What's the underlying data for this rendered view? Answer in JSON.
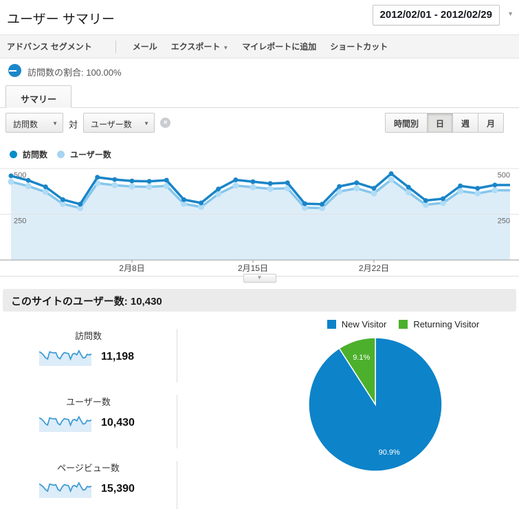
{
  "header": {
    "title": "ユーザー サマリー",
    "date_range": "2012/02/01 - 2012/02/29"
  },
  "icons": {
    "dropdown": "▼",
    "clear": "×",
    "collapse": "▼"
  },
  "toolbar": {
    "advanced_segment": "アドバンス セグメント",
    "mail": "メール",
    "export": "エクスポート",
    "add_to_dashboard": "マイレポートに追加",
    "shortcut": "ショートカット"
  },
  "segment": {
    "label": "訪問数の割合: 100.00%"
  },
  "tabs": {
    "summary": "サマリー"
  },
  "controls": {
    "metric_primary": "訪問数",
    "vs": "対",
    "metric_secondary": "ユーザー数",
    "granularity": [
      {
        "label": "時間別",
        "active": false
      },
      {
        "label": "日",
        "active": true
      },
      {
        "label": "週",
        "active": false
      },
      {
        "label": "月",
        "active": false
      }
    ]
  },
  "legend": {
    "series1": {
      "label": "訪問数",
      "color": "#058dc7"
    },
    "series2": {
      "label": "ユーザー数",
      "color": "#a5d5f0"
    }
  },
  "chart_data": [
    {
      "type": "line",
      "title": "訪問数 対 ユーザー数（日別）",
      "x_range": "2012/02/01 - 2012/02/29",
      "xtick_labels": [
        "2月8日",
        "2月15日",
        "2月22日"
      ],
      "xtick_days": [
        8,
        15,
        22
      ],
      "ylim": [
        0,
        500
      ],
      "yticks": [
        250,
        500
      ],
      "grid": true,
      "series": [
        {
          "name": "訪問数",
          "color": "#1a85c8",
          "dot_color": "#1a85c8",
          "values": [
            460,
            435,
            400,
            330,
            305,
            452,
            440,
            432,
            430,
            436,
            330,
            312,
            388,
            438,
            428,
            418,
            422,
            308,
            305,
            402,
            422,
            392,
            472,
            398,
            325,
            335,
            405,
            392,
            410
          ]
        },
        {
          "name": "ユーザー数",
          "color": "#85c6ec",
          "dot_color": "#b0dcf5",
          "values": [
            428,
            404,
            372,
            307,
            284,
            420,
            409,
            402,
            400,
            405,
            307,
            290,
            361,
            407,
            398,
            389,
            392,
            286,
            284,
            374,
            392,
            364,
            439,
            370,
            302,
            312,
            377,
            364,
            381
          ]
        }
      ],
      "fill_color": "#ddedf8"
    },
    {
      "type": "pie",
      "title": "New vs Returning",
      "legend_position": "top",
      "slices": [
        {
          "label": "New Visitor",
          "value": 90.9,
          "display": "90.9%",
          "color": "#0d83c9"
        },
        {
          "label": "Returning Visitor",
          "value": 9.1,
          "display": "9.1%",
          "color": "#4cb02c"
        }
      ]
    }
  ],
  "summary_bar": {
    "label": "このサイトのユーザー数:",
    "value": "10,430"
  },
  "metrics": [
    {
      "label": "訪問数",
      "value": "11,198",
      "spark": [
        452,
        430,
        392,
        337,
        310,
        450,
        436,
        430,
        434,
        340,
        315,
        390,
        436,
        425,
        418,
        310,
        405,
        420,
        392,
        470,
        396,
        330,
        340,
        402,
        390,
        408
      ]
    },
    {
      "label": "ユーザー数",
      "value": "10,430",
      "spark": [
        420,
        400,
        365,
        313,
        288,
        418,
        406,
        400,
        403,
        316,
        293,
        363,
        405,
        395,
        389,
        288,
        377,
        390,
        364,
        437,
        368,
        307,
        316,
        374,
        363,
        379
      ]
    },
    {
      "label": "ページビュー数",
      "value": "15,390",
      "spark": [
        620,
        585,
        540,
        470,
        428,
        615,
        600,
        588,
        596,
        470,
        435,
        538,
        600,
        585,
        575,
        428,
        558,
        578,
        540,
        648,
        545,
        455,
        468,
        553,
        538,
        562
      ]
    }
  ],
  "pie_legend": [
    {
      "label": "New Visitor",
      "color": "#0d83c9"
    },
    {
      "label": "Returning Visitor",
      "color": "#4cb02c"
    }
  ]
}
